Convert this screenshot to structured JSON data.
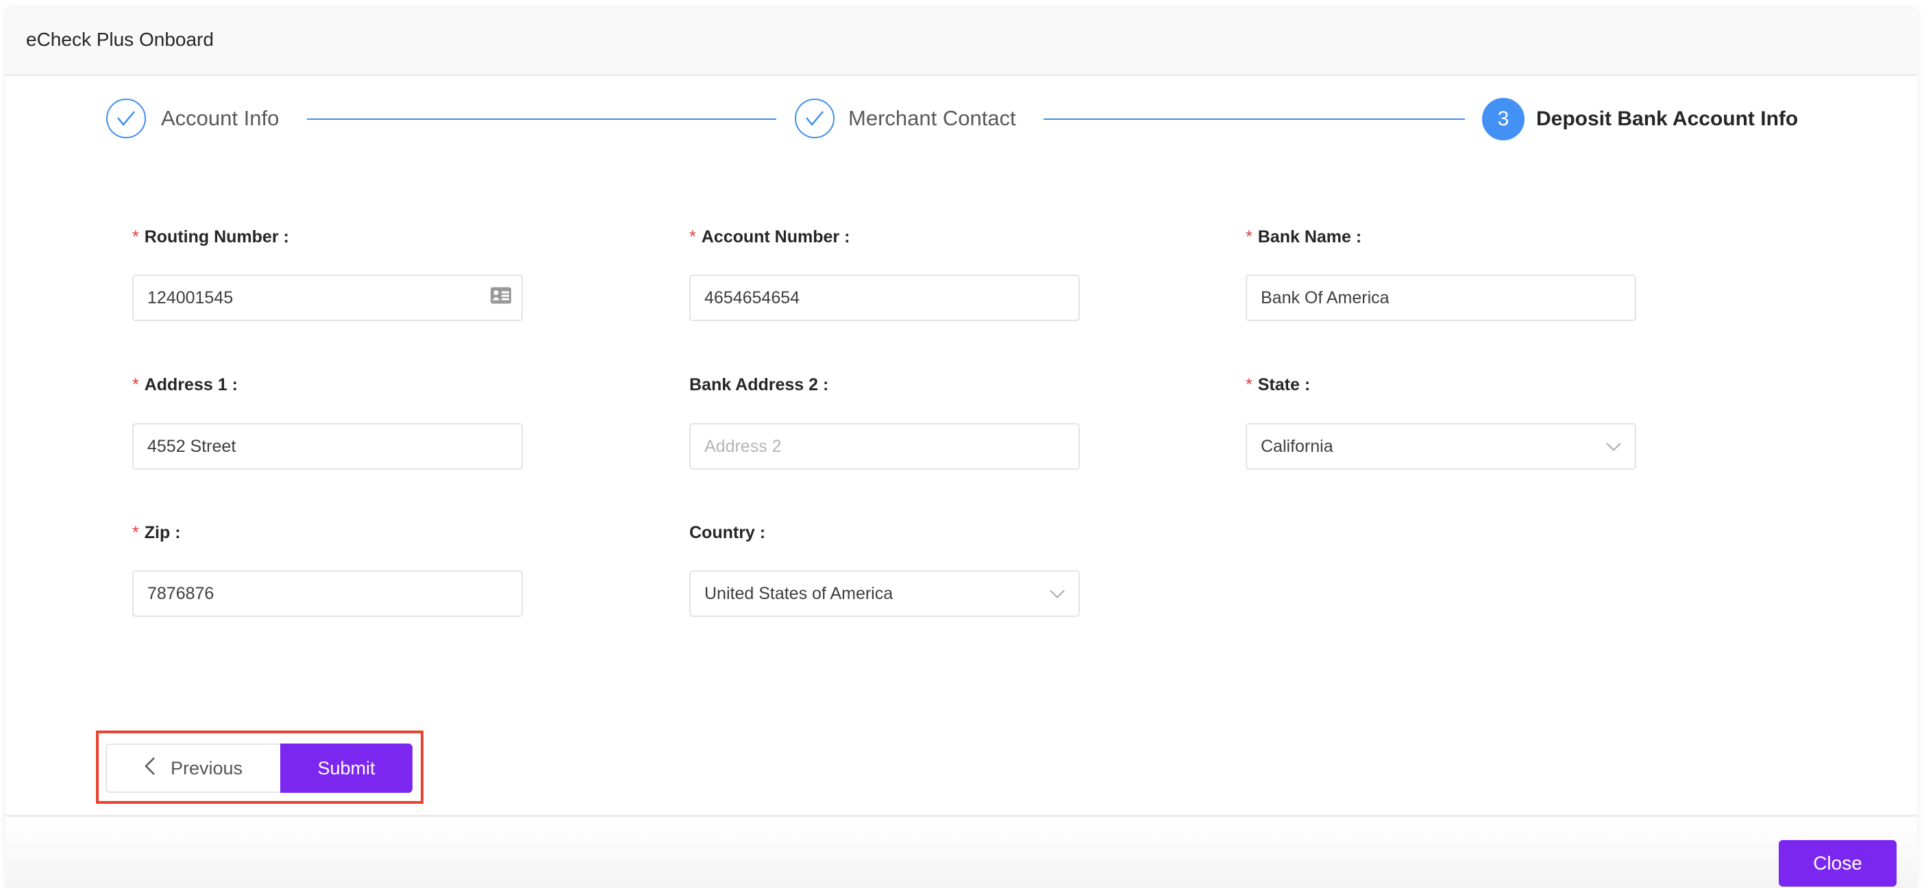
{
  "window": {
    "title": "eCheck Plus Onboard"
  },
  "steps": [
    {
      "number": "1",
      "label": "Account Info",
      "status": "done",
      "icon": "check-icon"
    },
    {
      "number": "2",
      "label": "Merchant Contact",
      "status": "done",
      "icon": "check-icon"
    },
    {
      "number": "3",
      "label": "Deposit Bank Account Info",
      "status": "active"
    }
  ],
  "form": {
    "routing": {
      "label": "Routing Number",
      "required": "*",
      "value": "124001545",
      "icon": "id-card-icon"
    },
    "account": {
      "label": "Account Number",
      "required": "*",
      "value": "4654654654"
    },
    "bank_name": {
      "label": "Bank Name",
      "required": "*",
      "value": "Bank Of America"
    },
    "address1": {
      "label": "Address 1",
      "required": "*",
      "value": "4552 Street"
    },
    "address2": {
      "label": "Bank Address 2",
      "value": "",
      "placeholder": "Address 2"
    },
    "state": {
      "label": "State",
      "required": "*",
      "value": "California"
    },
    "zip": {
      "label": "Zip",
      "required": "*",
      "value": "7876876"
    },
    "country": {
      "label": "Country",
      "value": "United States of America"
    },
    "colon": ":"
  },
  "actions": {
    "previous": "Previous",
    "submit": "Submit",
    "close": "Close"
  },
  "colors": {
    "accent": "#7b27f0",
    "step": "#4391f5",
    "required": "#e53935",
    "highlight": "#e8432e"
  }
}
